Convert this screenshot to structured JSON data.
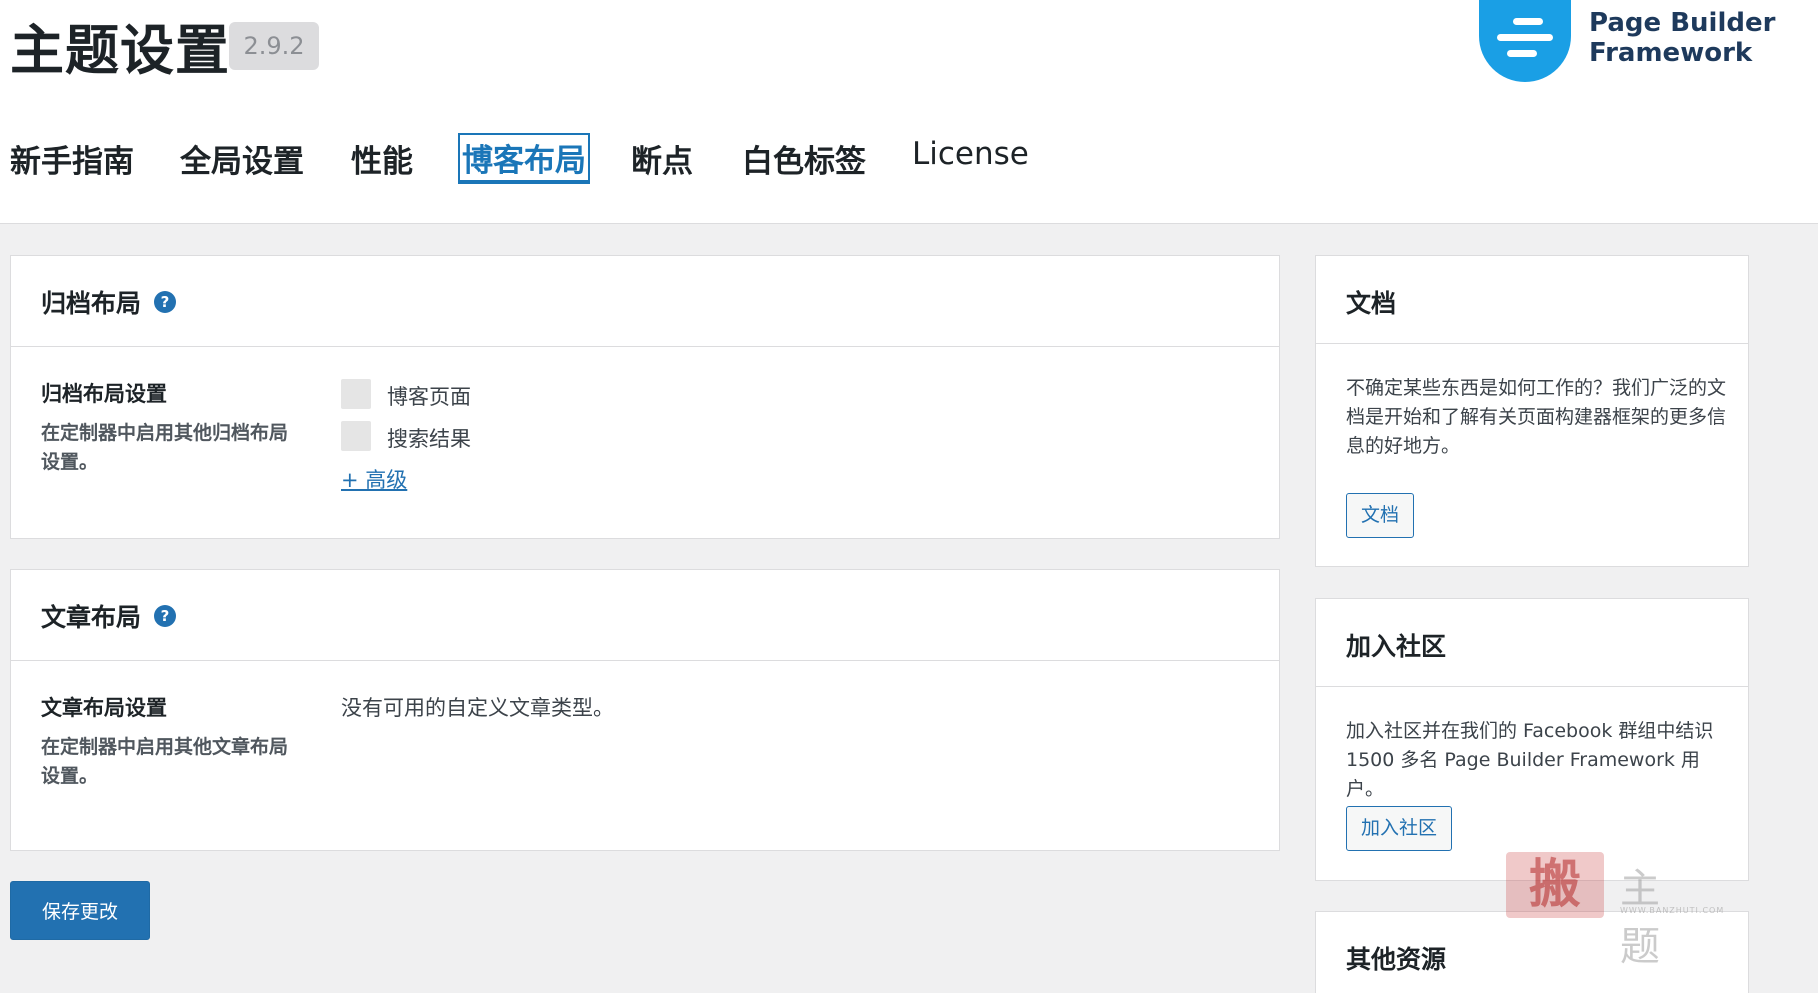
{
  "header": {
    "title": "主题设置",
    "version": "2.9.2",
    "logo_line1": "Page Builder",
    "logo_line2": "Framework"
  },
  "nav": {
    "tabs": [
      {
        "label": "新手指南",
        "active": false
      },
      {
        "label": "全局设置",
        "active": false
      },
      {
        "label": "性能",
        "active": false
      },
      {
        "label": "博客布局",
        "active": true
      },
      {
        "label": "断点",
        "active": false
      },
      {
        "label": "白色标签",
        "active": false
      },
      {
        "label": "License",
        "active": false
      }
    ]
  },
  "archive": {
    "title": "归档布局",
    "help": "?",
    "row_label": "归档布局设置",
    "row_desc": "在定制器中启用其他归档布局设置。",
    "options": [
      "博客页面",
      "搜索结果"
    ],
    "advanced_link": "+ 高级"
  },
  "post": {
    "title": "文章布局",
    "help": "?",
    "row_label": "文章布局设置",
    "row_desc": "在定制器中启用其他文章布局设置。",
    "empty_text": "没有可用的自定义文章类型。"
  },
  "save_button": "保存更改",
  "sidebar": {
    "docs": {
      "title": "文档",
      "text": "不确定某些东西是如何工作的？我们广泛的文档是开始和了解有关页面构建器框架的更多信息的好地方。",
      "button": "文档"
    },
    "community": {
      "title": "加入社区",
      "text": "加入社区并在我们的 Facebook 群组中结识 1500 多名 Page Builder Framework 用户。",
      "button": "加入社区"
    },
    "resources": {
      "title": "其他资源"
    }
  },
  "watermark": {
    "stamp": "搬",
    "text": "主题",
    "small": "WWW.BANZHUTI.COM"
  },
  "colors": {
    "accent": "#2271b1",
    "logo_blue": "#1a9fe5",
    "logo_text": "#1e3a5c"
  }
}
